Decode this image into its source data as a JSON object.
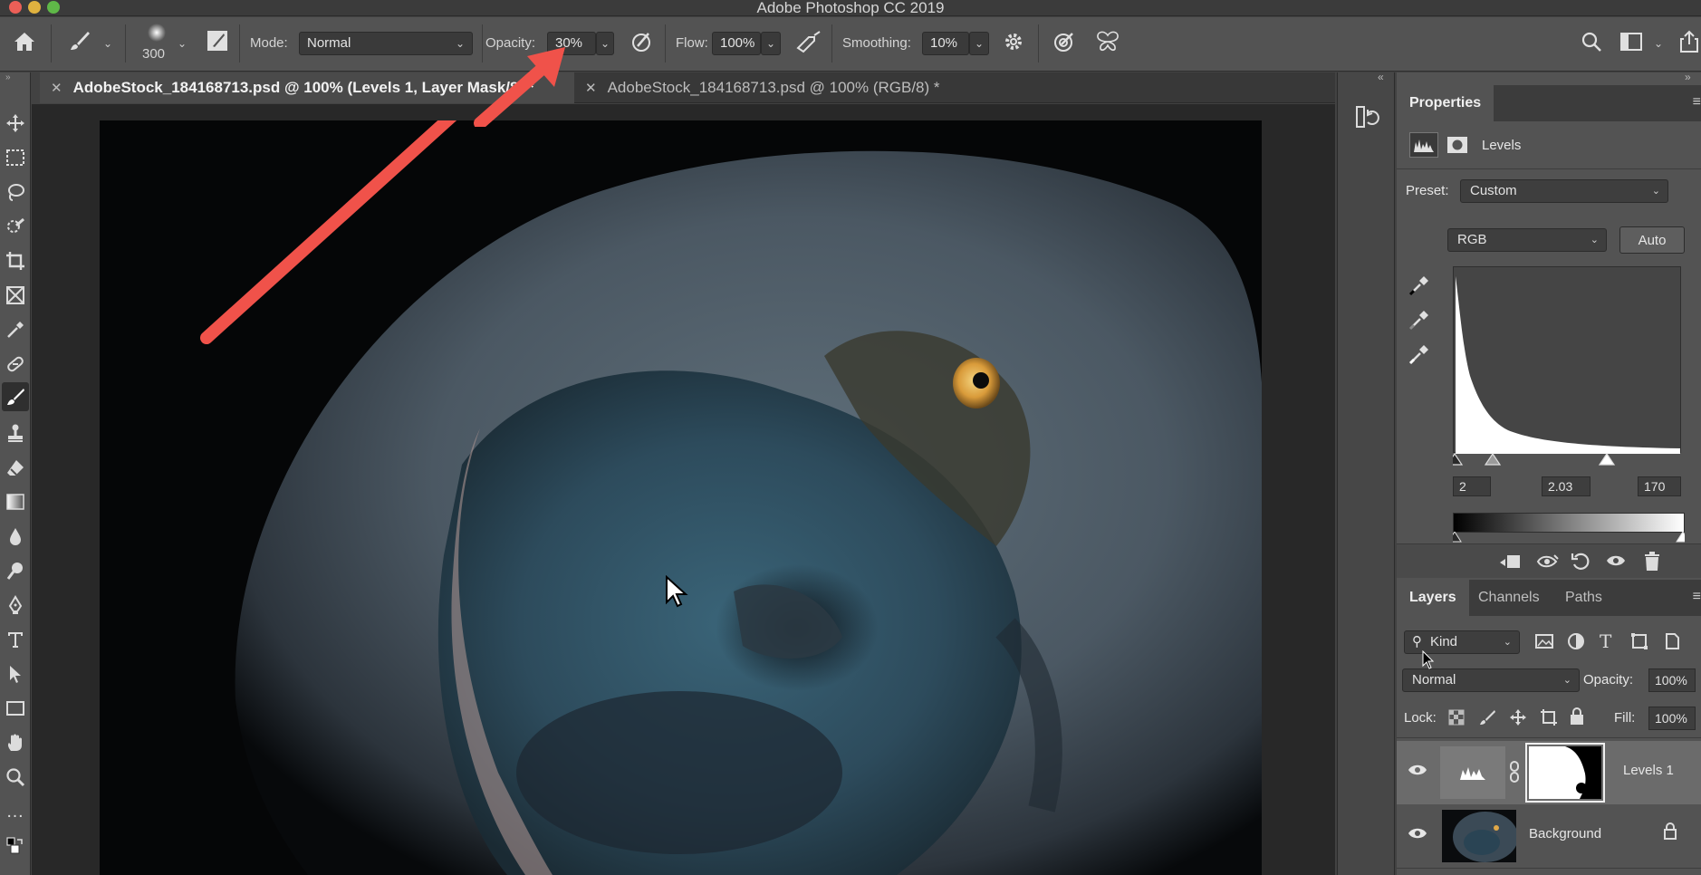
{
  "window": {
    "title": "Adobe Photoshop CC 2019"
  },
  "options_bar": {
    "brush_size": "300",
    "mode_label": "Mode:",
    "mode_value": "Normal",
    "opacity_label": "Opacity:",
    "opacity_value": "30%",
    "flow_label": "Flow:",
    "flow_value": "100%",
    "smoothing_label": "Smoothing:",
    "smoothing_value": "10%"
  },
  "tabs": [
    {
      "label": "AdobeStock_184168713.psd @ 100% (Levels 1, Layer Mask/8) *",
      "active": true
    },
    {
      "label": "AdobeStock_184168713.psd @ 100% (RGB/8) *",
      "active": false
    }
  ],
  "properties": {
    "title": "Properties",
    "adjustment_name": "Levels",
    "preset_label": "Preset:",
    "preset_value": "Custom",
    "channel_value": "RGB",
    "auto_label": "Auto",
    "input_black": "2",
    "input_gamma": "2.03",
    "input_white": "170"
  },
  "layers_panel": {
    "tabs": [
      "Layers",
      "Channels",
      "Paths"
    ],
    "filter_value": "Kind",
    "blend_mode": "Normal",
    "opacity_label": "Opacity:",
    "opacity_value": "100%",
    "lock_label": "Lock:",
    "fill_label": "Fill:",
    "fill_value": "100%",
    "layers": [
      {
        "name": "Levels 1",
        "selected": true
      },
      {
        "name": "Background",
        "selected": false
      }
    ]
  },
  "colors": {
    "annotation_arrow": "#f0524a",
    "panel_bg": "#535353",
    "canvas_bg": "#282828"
  }
}
